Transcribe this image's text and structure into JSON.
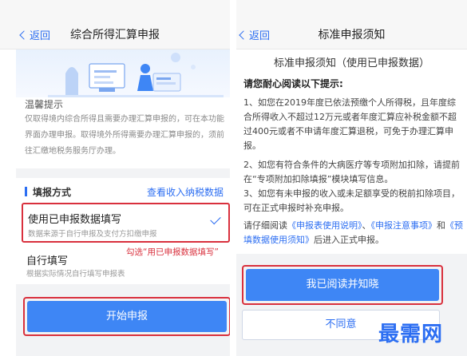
{
  "left": {
    "nav": {
      "back": "返回",
      "title": "综合所得汇算申报"
    },
    "tips": {
      "title": "温馨提示",
      "text": "仅取得境内综合所得且需要办理汇算申报的，可在本功能界面办理申报。取得境外所得需要办理汇算申报的，须前往汇缴地税务服务厅办理。"
    },
    "section": {
      "title": "填报方式",
      "link": "查看收入纳税数据"
    },
    "option_prefilled": {
      "title": "使用已申报数据填写",
      "desc": "数据来源于自行申报及支付方扣缴申报"
    },
    "option_self": {
      "title": "自行填写",
      "desc": "根据实际情况自行填写申报表"
    },
    "annotation": "勾选“用已申报数据填写”",
    "start_button": "开始申报"
  },
  "right": {
    "nav": {
      "back": "返回",
      "title": "标准申报须知"
    },
    "doc_title": "标准申报须知（使用已申报数据）",
    "notice_head": "请您耐心阅读以下提示:",
    "para1": "1、如您在2019年度已依法预缴个人所得税，且年度综合所得收入不超过12万元或者年度汇算应补税金额不超过400元或者不申请年度汇算退税，可免于办理汇算申报。",
    "para2": "2、如您有符合条件的大病医疗等专项附加扣除，请提前在“专项附加扣除填报”模块填写信息。",
    "para3": "3、如您有未申报的收入或未足额享受的税前扣除项目，可在正式申报时补充申报。",
    "para4": {
      "pre": "请仔细阅读",
      "link1": "《申报表使用说明》",
      "sep1": "、",
      "link2": "《申报注意事项》",
      "and": "和",
      "link3": "《预填数据使用须知》",
      "post": "后进入正式申报。"
    },
    "agree_button": "我已阅读并知晓",
    "disagree_button": "不同意"
  },
  "watermark": "最需网",
  "colors": {
    "primary": "#3e86f5",
    "link": "#2c6ef2",
    "highlight": "#d9303d"
  }
}
